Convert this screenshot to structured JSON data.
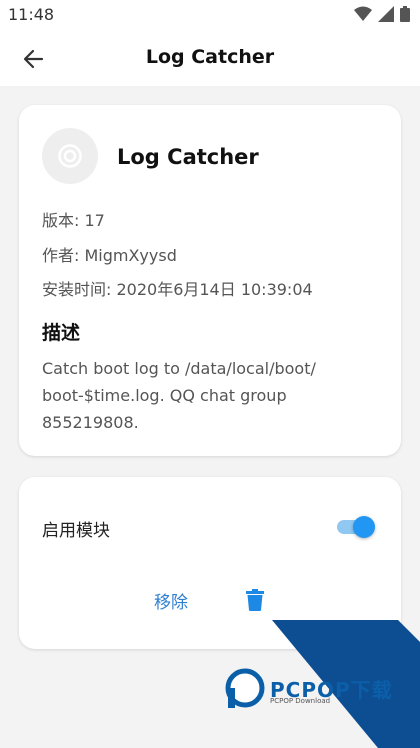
{
  "status_bar": {
    "time": "11:48"
  },
  "app_bar": {
    "title": "Log Catcher"
  },
  "module": {
    "name": "Log Catcher",
    "version_line": "版本: 17",
    "author_line": "作者: MigmXyysd",
    "installed_line": "安装时间: 2020年6月14日 10:39:04",
    "description_heading": "描述",
    "description": "Catch boot log to /data/local/boot/ boot-$time.log. QQ chat group 855219808."
  },
  "controls": {
    "enable_label": "启用模块",
    "enabled": true,
    "remove_label": "移除"
  },
  "watermark": {
    "brand": "PCPOP下载",
    "sub": "PCPOP Download"
  },
  "colors": {
    "accent": "#2196f3",
    "remove_text": "#2f7fd1",
    "watermark": "#0b5fa8"
  }
}
